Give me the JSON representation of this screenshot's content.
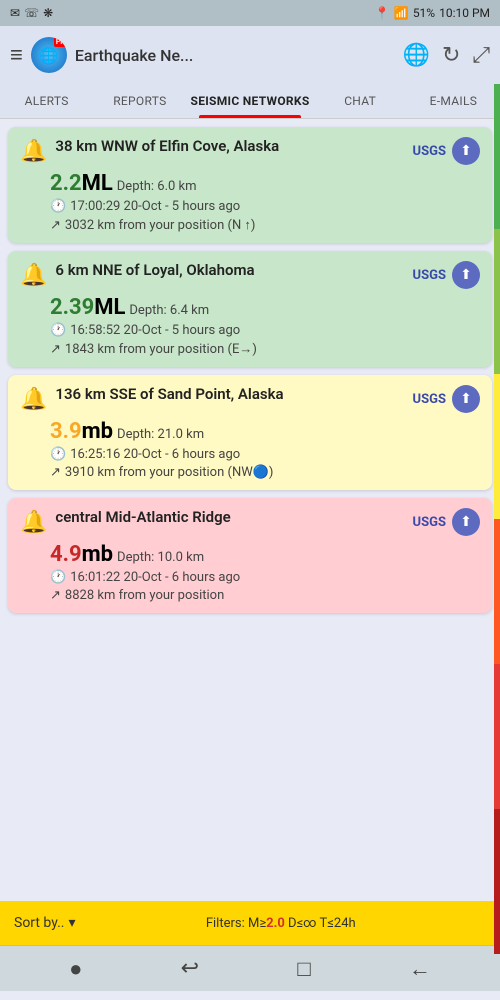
{
  "statusBar": {
    "leftIcons": [
      "✉",
      "☏",
      "❋"
    ],
    "location": "📍",
    "signal": "📶",
    "battery": "51%",
    "time": "10:10 PM"
  },
  "topBar": {
    "title": "Earthquake Ne...",
    "menuIcon": "≡",
    "globeIcon": "🌐",
    "refreshIcon": "↻",
    "expandIcon": "⤢"
  },
  "tabs": [
    {
      "id": "alerts",
      "label": "ALERTS",
      "active": false
    },
    {
      "id": "reports",
      "label": "REPORTS",
      "active": false
    },
    {
      "id": "seismic",
      "label": "SEISMIC NETWORKS",
      "active": true
    },
    {
      "id": "chat",
      "label": "CHAT",
      "active": false
    },
    {
      "id": "emails",
      "label": "E-MAILS",
      "active": false
    }
  ],
  "earthquakes": [
    {
      "id": 1,
      "color": "green",
      "title": "38 km WNW of Elfin Cove, Alaska",
      "magnitude": "2.2",
      "magType": "ML",
      "depth": "6.0 km",
      "time": "17:00:29 20-Oct - 5 hours ago",
      "distance": "3032 km from your position (N ↑)",
      "source": "USGS",
      "magColor": "green-mag"
    },
    {
      "id": 2,
      "color": "green",
      "title": "6 km NNE of Loyal, Oklahoma",
      "magnitude": "2.39",
      "magType": "ML",
      "depth": "6.4 km",
      "time": "16:58:52 20-Oct - 5 hours ago",
      "distance": "1843 km from your position (E→)",
      "source": "USGS",
      "magColor": "green-mag"
    },
    {
      "id": 3,
      "color": "yellow",
      "title": "136 km SSE of Sand Point, Alaska",
      "magnitude": "3.9",
      "magType": "mb",
      "depth": "21.0 km",
      "time": "16:25:16 20-Oct - 6 hours ago",
      "distance": "3910 km from your position (NW🔵)",
      "source": "USGS",
      "magColor": "yellow-mag"
    },
    {
      "id": 4,
      "color": "red",
      "title": "central Mid-Atlantic Ridge",
      "magnitude": "4.9",
      "magType": "mb",
      "depth": "10.0 km",
      "time": "16:01:22 20-Oct - 6 hours ago",
      "distance": "8828 km from your position",
      "source": "USGS",
      "magColor": "red-mag"
    }
  ],
  "filterBar": {
    "sortLabel": "Sort by..",
    "filterText": "Filters: M≥",
    "filterM": "2.0",
    "filterD": "D≤∞",
    "filterT": "T≤24h"
  },
  "navBar": {
    "homeIcon": "●",
    "backIcon": "↩",
    "squareIcon": "□",
    "prevIcon": "←"
  }
}
